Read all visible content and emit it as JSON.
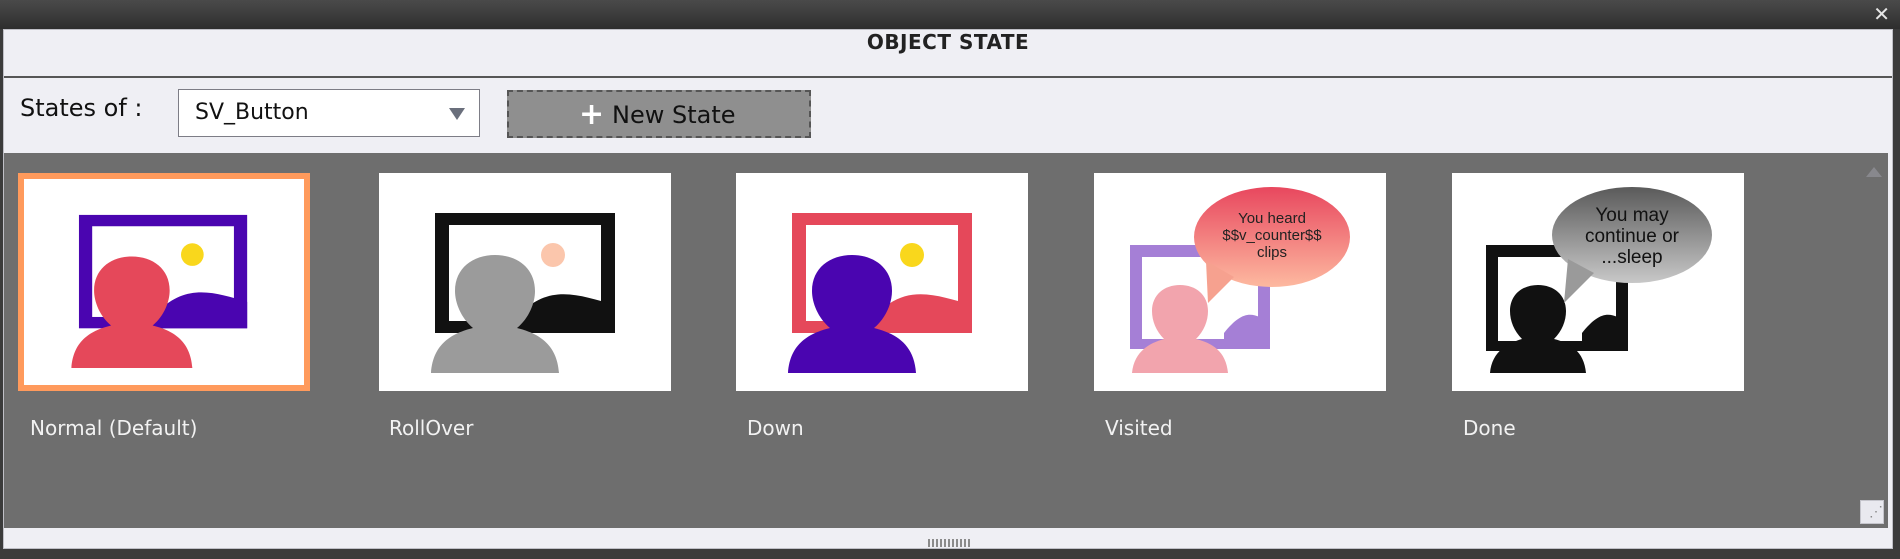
{
  "window": {
    "title": "OBJECT STATE",
    "close_icon": "close-icon"
  },
  "toolbar": {
    "states_label": "States of :",
    "object_select": "SV_Button",
    "new_state_label": "New State",
    "new_state_icon": "plus-icon"
  },
  "states": [
    {
      "label": "Normal (Default)",
      "selected": true
    },
    {
      "label": "RollOver",
      "selected": false
    },
    {
      "label": "Down",
      "selected": false
    },
    {
      "label": "Visited",
      "selected": false,
      "bubble_text": [
        "You heard",
        "$$v_counter$$",
        "clips"
      ]
    },
    {
      "label": "Done",
      "selected": false,
      "bubble_text": [
        "You may",
        "continue or",
        "...sleep"
      ]
    }
  ],
  "colors": {
    "selected_border": "#ff9a5c",
    "panel_bg": "#6e6e6e",
    "purple": "#4a05b0",
    "red": "#e5485a",
    "yellow": "#f9d71c"
  }
}
